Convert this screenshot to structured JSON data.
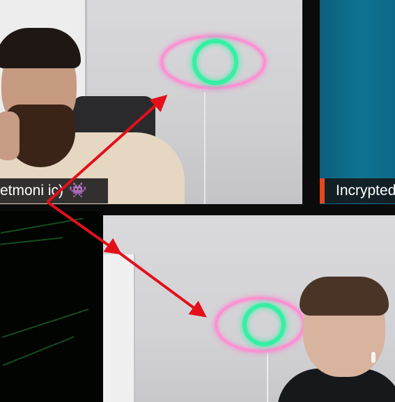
{
  "tiles": {
    "top_left": {
      "name_tag": "etmoni",
      "name_tag_suffix": "ic)",
      "emoji_glyph": "👾"
    },
    "top_right": {
      "name_tag": "Incrypted"
    }
  },
  "colors": {
    "arrow": "#e3101a",
    "neon_eye_outline": "#ff8fd4",
    "neon_eye_iris": "#35f0a4",
    "name_tag_accent": "#e8461d"
  },
  "icons": [
    "alien-monster-emoji",
    "neon-eye-sign",
    "red-arrow"
  ]
}
